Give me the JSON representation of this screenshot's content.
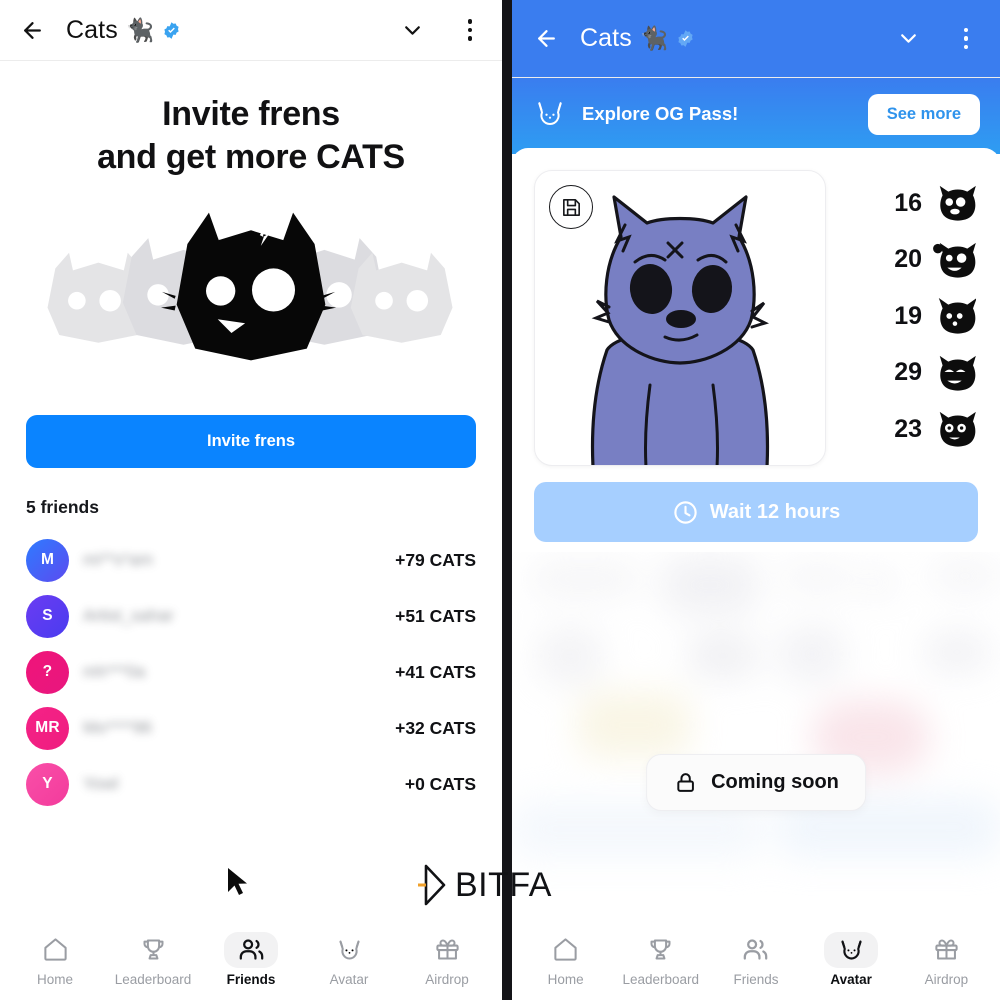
{
  "left_panel": {
    "header": {
      "back_icon": "arrow-left-icon",
      "title": "Cats",
      "title_emoji": "🐈‍⬛",
      "verified_icon": "verified-badge-icon",
      "collapse_icon": "chevron-down-icon",
      "menu_icon": "kebab-menu-icon"
    },
    "invite": {
      "title_line1": "Invite frens",
      "title_line2": "and get more CATS",
      "hero_icon": "cats-logo-icon",
      "button_label": "Invite frens",
      "button_color": "#0a84ff"
    },
    "friends_section": {
      "count_label": "5 friends",
      "rows": [
        {
          "initials": "M",
          "name": "mi**s*am",
          "amount": "+79 CATS",
          "color_a": "#2f7bff",
          "color_b": "#5b4bf0"
        },
        {
          "initials": "S",
          "name": "Artist_sahar",
          "amount": "+51 CATS",
          "color_a": "#6b3df2",
          "color_b": "#4a3bf0"
        },
        {
          "initials": "?",
          "name": "mh***0a",
          "amount": "+41 CATS",
          "color_a": "#f0147a",
          "color_b": "#e8177e"
        },
        {
          "initials": "MR",
          "name": "Mo****96",
          "amount": "+32 CATS",
          "color_a": "#f52287",
          "color_b": "#ef1d7f"
        },
        {
          "initials": "Y",
          "name": "Yowl",
          "amount": "+0 CATS",
          "color_a": "#f94fa8",
          "color_b": "#f33b9c"
        }
      ]
    },
    "bottom_nav": {
      "items": [
        {
          "label": "Home",
          "icon": "home-icon",
          "active": false
        },
        {
          "label": "Leaderboard",
          "icon": "trophy-icon",
          "active": false
        },
        {
          "label": "Friends",
          "icon": "people-icon",
          "active": true
        },
        {
          "label": "Avatar",
          "icon": "cat-face-icon",
          "active": false
        },
        {
          "label": "Airdrop",
          "icon": "gift-icon",
          "active": false
        }
      ]
    }
  },
  "right_panel": {
    "header": {
      "back_icon": "arrow-left-icon",
      "title": "Cats",
      "title_emoji": "🐈‍⬛",
      "verified_icon": "verified-badge-icon",
      "collapse_icon": "chevron-down-icon",
      "menu_icon": "kebab-menu-icon",
      "background_color": "#3a7def"
    },
    "banner": {
      "icon": "cat-outline-icon",
      "text": "Explore OG Pass!",
      "button_label": "See more",
      "gradient_from": "#3a7def",
      "gradient_to": "#2e9df2"
    },
    "avatar_card": {
      "save_icon": "save-floppy-icon",
      "avatar_icon": "blue-cat-avatar",
      "avatar_body_color": "#7a80c4"
    },
    "stats": [
      {
        "value": "16",
        "icon": "cat-face-black-icon"
      },
      {
        "value": "20",
        "icon": "cat-face-black-icon"
      },
      {
        "value": "19",
        "icon": "cat-face-black-icon"
      },
      {
        "value": "29",
        "icon": "cat-face-black-icon"
      },
      {
        "value": "23",
        "icon": "cat-face-black-icon"
      }
    ],
    "wait_button": {
      "label": "Wait 12 hours",
      "icon": "clock-icon",
      "color": "#a6cfff"
    },
    "locked_overlay": {
      "icon": "lock-icon",
      "label": "Coming soon"
    },
    "bottom_nav": {
      "items": [
        {
          "label": "Home",
          "icon": "home-icon",
          "active": false
        },
        {
          "label": "Leaderboard",
          "icon": "trophy-icon",
          "active": false
        },
        {
          "label": "Friends",
          "icon": "people-icon",
          "active": false
        },
        {
          "label": "Avatar",
          "icon": "cat-face-icon",
          "active": true
        },
        {
          "label": "Airdrop",
          "icon": "gift-icon",
          "active": false
        }
      ]
    }
  },
  "watermark": {
    "logo_icon": "bitfa-logo-icon",
    "text": "BITFA",
    "accent_color": "#f0a02a"
  }
}
